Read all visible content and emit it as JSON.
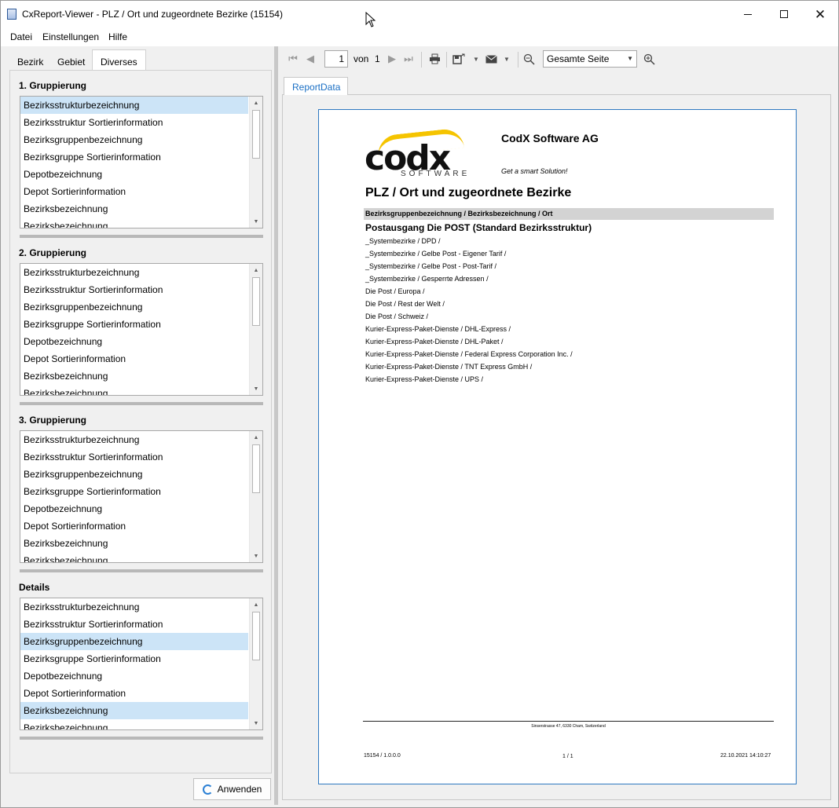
{
  "window": {
    "title": "CxReport-Viewer - PLZ / Ort und zugeordnete Bezirke (15154)"
  },
  "menu": {
    "items": [
      "Datei",
      "Einstellungen",
      "Hilfe"
    ]
  },
  "left_tabs": [
    "Bezirk",
    "Gebiet",
    "Diverses"
  ],
  "active_tab": "Diverses",
  "groups": [
    {
      "label": "1. Gruppierung",
      "items": [
        "Bezirksstrukturbezeichnung",
        "Bezirksstruktur Sortierinformation",
        "Bezirksgruppenbezeichnung",
        "Bezirksgruppe Sortierinformation",
        "Depotbezeichnung",
        "Depot Sortierinformation",
        "Bezirksbezeichnung",
        "Bezirksbezeichnung"
      ],
      "selected": [
        "Bezirksstrukturbezeichnung"
      ]
    },
    {
      "label": "2. Gruppierung",
      "items": [
        "Bezirksstrukturbezeichnung",
        "Bezirksstruktur Sortierinformation",
        "Bezirksgruppenbezeichnung",
        "Bezirksgruppe Sortierinformation",
        "Depotbezeichnung",
        "Depot Sortierinformation",
        "Bezirksbezeichnung",
        "Bezirksbezeichnung"
      ],
      "selected": []
    },
    {
      "label": "3. Gruppierung",
      "items": [
        "Bezirksstrukturbezeichnung",
        "Bezirksstruktur Sortierinformation",
        "Bezirksgruppenbezeichnung",
        "Bezirksgruppe Sortierinformation",
        "Depotbezeichnung",
        "Depot Sortierinformation",
        "Bezirksbezeichnung",
        "Bezirksbezeichnung"
      ],
      "selected": []
    },
    {
      "label": "Details",
      "items": [
        "Bezirksstrukturbezeichnung",
        "Bezirksstruktur Sortierinformation",
        "Bezirksgruppenbezeichnung",
        "Bezirksgruppe Sortierinformation",
        "Depotbezeichnung",
        "Depot Sortierinformation",
        "Bezirksbezeichnung",
        "Bezirksbezeichnung"
      ],
      "selected": [
        "Bezirksgruppenbezeichnung",
        "Bezirksbezeichnung"
      ]
    }
  ],
  "apply_button": "Anwenden",
  "toolbar": {
    "page_current": "1",
    "page_of_label": "von",
    "page_total": "1",
    "zoom_value": "Gesamte Seite"
  },
  "report_tab": "ReportData",
  "report": {
    "logo_text": "codx",
    "logo_sub": "SOFTWARE",
    "company": "CodX Software AG",
    "slogan": "Get a smart Solution!",
    "title": "PLZ / Ort und zugeordnete Bezirke",
    "column_header": "Bezirksgruppenbezeichnung / Bezirksbezeichnung / Ort",
    "group_heading": "Postausgang Die POST (Standard Bezirksstruktur)",
    "rows": [
      "_Systembezirke / DPD /",
      "_Systembezirke / Gelbe Post - Eigener Tarif /",
      "_Systembezirke / Gelbe Post - Post-Tarif /",
      "_Systembezirke / Gesperrte Adressen /",
      "Die Post / Europa /",
      "Die Post / Rest der Welt /",
      "Die Post / Schweiz /",
      "Kurier-Express-Paket-Dienste / DHL-Express /",
      "Kurier-Express-Paket-Dienste / DHL-Paket /",
      "Kurier-Express-Paket-Dienste / Federal Express Corporation Inc. /",
      "Kurier-Express-Paket-Dienste / TNT Express GmbH /",
      "Kurier-Express-Paket-Dienste / UPS /"
    ],
    "footer_address": "Sinserstrasse 47, 6330 Cham, Switzerland",
    "footer_left": "15154 / 1.0.0.0",
    "footer_center": "1 / 1",
    "footer_right": "22.10.2021 14:10:27"
  },
  "colors": {
    "selection": "#cce4f7",
    "accent": "#2e78c0",
    "logo_yellow": "#f5c400"
  }
}
